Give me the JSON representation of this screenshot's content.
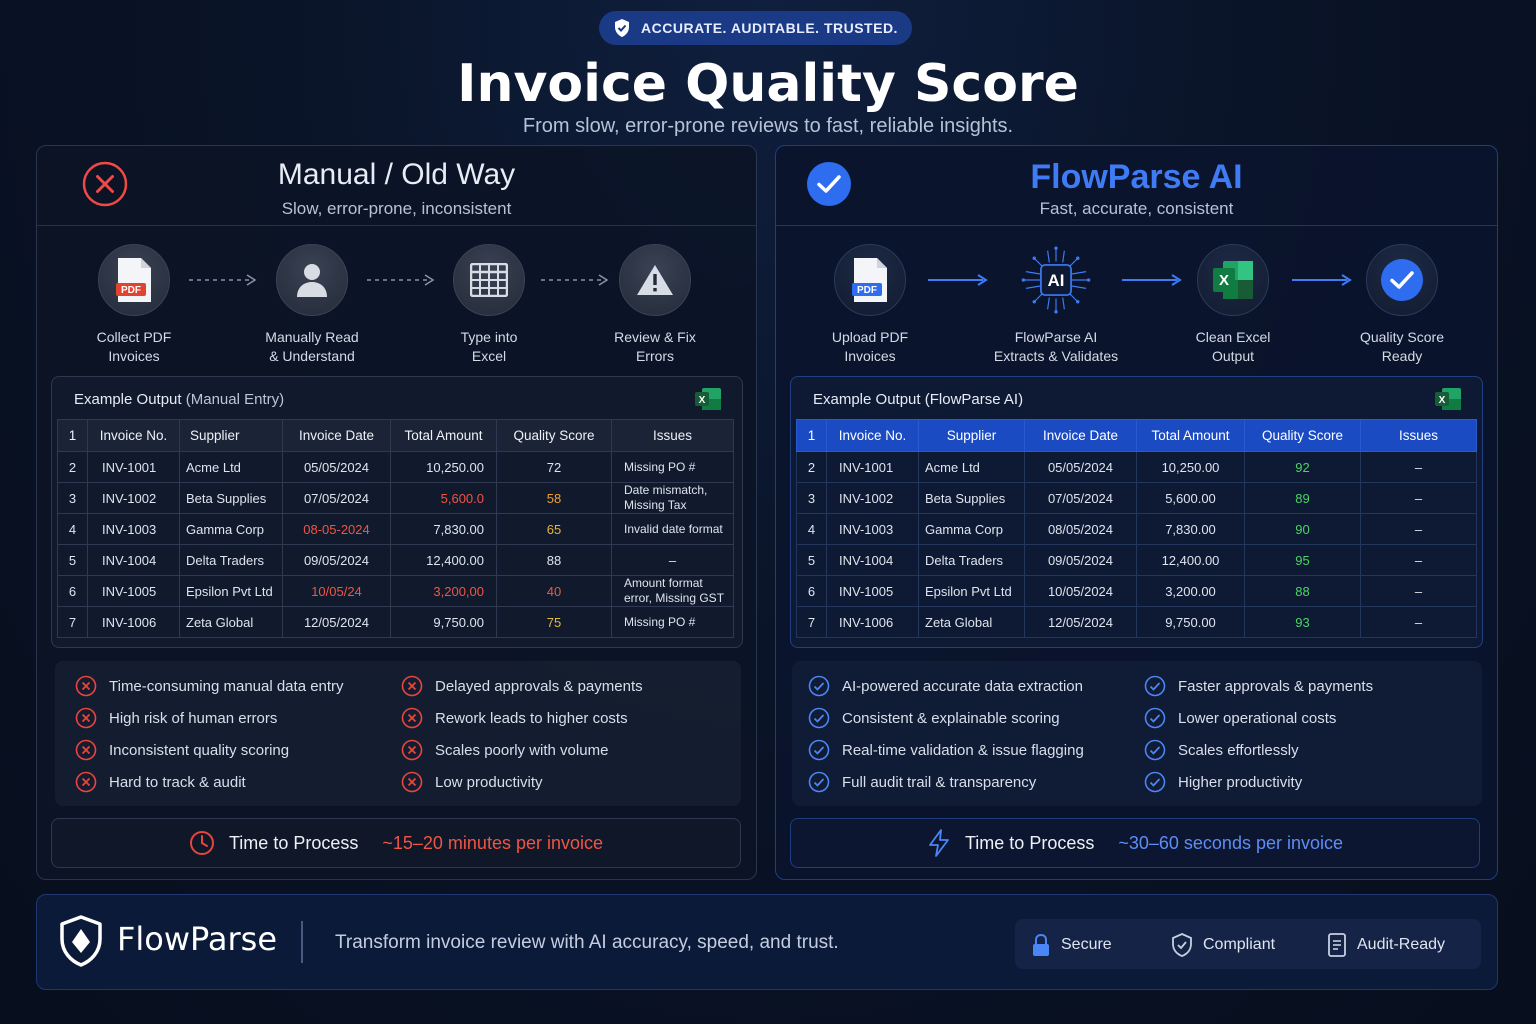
{
  "badge": {
    "text": "ACCURATE. AUDITABLE. TRUSTED.",
    "icon": "shield-check-icon"
  },
  "title": "Invoice Quality Score",
  "subtitle": "From slow, error-prone reviews to fast, reliable insights.",
  "manual": {
    "title": "Manual / Old Way",
    "subtitle": "Slow, error-prone, inconsistent",
    "steps": [
      {
        "label": "Collect PDF\nInvoices",
        "icon": "pdf-icon"
      },
      {
        "label": "Manually Read\n& Understand",
        "icon": "person-icon"
      },
      {
        "label": "Type into\nExcel",
        "icon": "grid-icon"
      },
      {
        "label": "Review & Fix\nErrors",
        "icon": "warning-icon"
      }
    ],
    "table_title": "Example Output",
    "table_title_suffix": "(Manual Entry)",
    "headers": [
      "1",
      "Invoice No.",
      "Supplier",
      "Invoice Date",
      "Total Amount",
      "Quality Score",
      "Issues"
    ],
    "rows": [
      {
        "n": "2",
        "inv": "INV-1001",
        "supplier": "Acme Ltd",
        "date": "05/05/2024",
        "amount": "10,250.00",
        "score": "72",
        "issues": "Missing PO #"
      },
      {
        "n": "3",
        "inv": "INV-1002",
        "supplier": "Beta Supplies",
        "date": "07/05/2024",
        "amount": "5,600.0",
        "score": "58",
        "issues": "Date mismatch, Missing Tax"
      },
      {
        "n": "4",
        "inv": "INV-1003",
        "supplier": "Gamma Corp",
        "date": "08-05-2024",
        "amount": "7,830.00",
        "score": "65",
        "issues": "Invalid date format"
      },
      {
        "n": "5",
        "inv": "INV-1004",
        "supplier": "Delta Traders",
        "date": "09/05/2024",
        "amount": "12,400.00",
        "score": "88",
        "issues": "–"
      },
      {
        "n": "6",
        "inv": "INV-1005",
        "supplier": "Epsilon Pvt Ltd",
        "date": "10/05/24",
        "amount": "3,200,00",
        "score": "40",
        "issues": "Amount format error, Missing GST"
      },
      {
        "n": "7",
        "inv": "INV-1006",
        "supplier": "Zeta Global",
        "date": "12/05/2024",
        "amount": "9,750.00",
        "score": "75",
        "issues": "Missing PO #"
      }
    ],
    "cons": [
      "Time-consuming manual data entry",
      "High risk of human errors",
      "Inconsistent quality scoring",
      "Hard to track & audit",
      "Delayed approvals & payments",
      "Rework leads to higher costs",
      "Scales poorly with volume",
      "Low productivity"
    ],
    "time_label": "Time to Process",
    "time_value": "~15–20 minutes per invoice"
  },
  "ai": {
    "title": "FlowParse AI",
    "subtitle": "Fast, accurate, consistent",
    "steps": [
      {
        "label": "Upload PDF\nInvoices",
        "icon": "pdf-icon"
      },
      {
        "label": "FlowParse AI\nExtracts & Validates",
        "icon": "ai-chip-icon",
        "chip_text": "AI"
      },
      {
        "label": "Clean Excel\nOutput",
        "icon": "excel-icon"
      },
      {
        "label": "Quality Score\nReady",
        "icon": "check-circle-icon"
      }
    ],
    "table_title": "Example Output",
    "table_title_suffix": "(FlowParse AI)",
    "headers": [
      "1",
      "Invoice No.",
      "Supplier",
      "Invoice Date",
      "Total Amount",
      "Quality Score",
      "Issues"
    ],
    "rows": [
      {
        "n": "2",
        "inv": "INV-1001",
        "supplier": "Acme Ltd",
        "date": "05/05/2024",
        "amount": "10,250.00",
        "score": "92",
        "issues": "–"
      },
      {
        "n": "3",
        "inv": "INV-1002",
        "supplier": "Beta Supplies",
        "date": "07/05/2024",
        "amount": "5,600.00",
        "score": "89",
        "issues": "–"
      },
      {
        "n": "4",
        "inv": "INV-1003",
        "supplier": "Gamma Corp",
        "date": "08/05/2024",
        "amount": "7,830.00",
        "score": "90",
        "issues": "–"
      },
      {
        "n": "5",
        "inv": "INV-1004",
        "supplier": "Delta Traders",
        "date": "09/05/2024",
        "amount": "12,400.00",
        "score": "95",
        "issues": "–"
      },
      {
        "n": "6",
        "inv": "INV-1005",
        "supplier": "Epsilon Pvt Ltd",
        "date": "10/05/2024",
        "amount": "3,200.00",
        "score": "88",
        "issues": "–"
      },
      {
        "n": "7",
        "inv": "INV-1006",
        "supplier": "Zeta Global",
        "date": "12/05/2024",
        "amount": "9,750.00",
        "score": "93",
        "issues": "–"
      }
    ],
    "pros": [
      "AI-powered accurate data extraction",
      "Consistent & explainable scoring",
      "Real-time validation & issue flagging",
      "Full audit trail & transparency",
      "Faster approvals & payments",
      "Lower operational costs",
      "Scales effortlessly",
      "Higher productivity"
    ],
    "time_label": "Time to Process",
    "time_value": "~30–60 seconds per invoice"
  },
  "footer": {
    "brand": "FlowParse",
    "tagline": "Transform invoice review with AI accuracy, speed, and trust.",
    "badges": [
      {
        "label": "Secure",
        "icon": "lock-icon"
      },
      {
        "label": "Compliant",
        "icon": "shield-check-icon"
      },
      {
        "label": "Audit-Ready",
        "icon": "document-icon"
      }
    ]
  },
  "colors": {
    "accent_blue": "#3f7bf5",
    "error_red": "#ef5545",
    "success_green": "#4cd364",
    "warning_orange": "#f0a030"
  }
}
